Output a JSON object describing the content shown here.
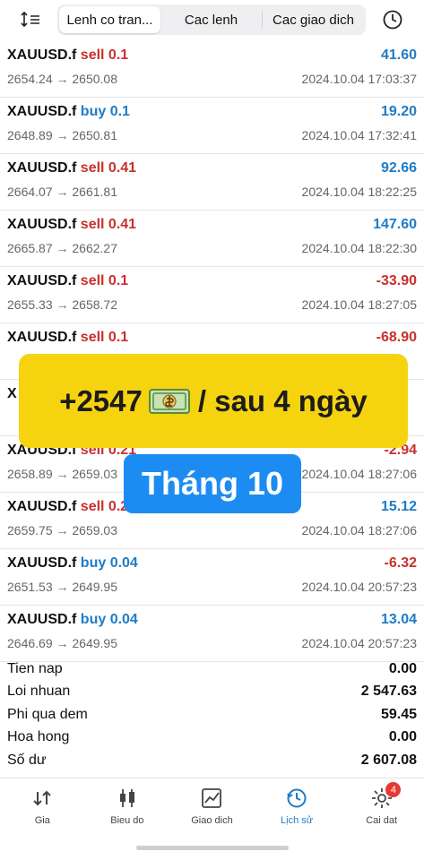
{
  "tabs": [
    {
      "label": "Lenh co tran..."
    },
    {
      "label": "Cac lenh"
    },
    {
      "label": "Cac giao dich"
    }
  ],
  "deals": [
    {
      "symbol": "XAUUSD.f",
      "side": "sell 0.1",
      "profit": "41.60",
      "prices": "2654.24 → 2650.08",
      "time": "2024.10.04 17:03:37"
    },
    {
      "symbol": "XAUUSD.f",
      "side": "buy 0.1",
      "profit": "19.20",
      "prices": "2648.89 → 2650.81",
      "time": "2024.10.04 17:32:41"
    },
    {
      "symbol": "XAUUSD.f",
      "side": "sell 0.41",
      "profit": "92.66",
      "prices": "2664.07 → 2661.81",
      "time": "2024.10.04 18:22:25"
    },
    {
      "symbol": "XAUUSD.f",
      "side": "sell 0.41",
      "profit": "147.60",
      "prices": "2665.87 → 2662.27",
      "time": "2024.10.04 18:22:30"
    },
    {
      "symbol": "XAUUSD.f",
      "side": "sell 0.1",
      "profit": "-33.90",
      "prices": "2655.33 → 2658.72",
      "time": "2024.10.04 18:27:05"
    },
    {
      "symbol": "XAUUSD.f",
      "side": "sell 0.1",
      "profit": "-68.90",
      "prices": "",
      "time": ""
    },
    {
      "symbol": "X",
      "side": "",
      "profit": "",
      "prices": "",
      "time": ""
    },
    {
      "symbol": "XAUUSD.f",
      "side": "sell 0.21",
      "profit": "-2.94",
      "prices": "2658.89 → 2659.03",
      "time": "2024.10.04 18:27:06"
    },
    {
      "symbol": "XAUUSD.f",
      "side": "sell 0.21",
      "profit": "15.12",
      "prices": "2659.75 → 2659.03",
      "time": "2024.10.04 18:27:06"
    },
    {
      "symbol": "XAUUSD.f",
      "side": "buy 0.04",
      "profit": "-6.32",
      "prices": "2651.53 → 2649.95",
      "time": "2024.10.04 20:57:23"
    },
    {
      "symbol": "XAUUSD.f",
      "side": "buy 0.04",
      "profit": "13.04",
      "prices": "2646.69 → 2649.95",
      "time": "2024.10.04 20:57:23"
    }
  ],
  "summary": [
    {
      "label": "Tien nap",
      "value": "0.00"
    },
    {
      "label": "Loi nhuan",
      "value": "2 547.63"
    },
    {
      "label": "Phi qua dem",
      "value": "59.45"
    },
    {
      "label": "Hoa hong",
      "value": "0.00"
    },
    {
      "label": "Số dư",
      "value": "2 607.08"
    }
  ],
  "nav": [
    {
      "label": "Gia",
      "icon": "price-arrows-icon"
    },
    {
      "label": "Bieu do",
      "icon": "candlestick-icon"
    },
    {
      "label": "Giao dich",
      "icon": "trade-chart-icon"
    },
    {
      "label": "Lịch sử",
      "icon": "history-clock-icon",
      "active": true
    },
    {
      "label": "Cai dat",
      "icon": "settings-gear-icon",
      "badge": "4"
    }
  ],
  "overlay": {
    "headline_left": "+2547",
    "headline_right": "/ sau 4 ngày",
    "month": "Tháng 10"
  },
  "colors": {
    "sell": "#c9302c",
    "buy": "#1e7cc6",
    "accent": "#1e7cc6",
    "banner_yellow": "#f6d30f",
    "banner_blue": "#1d8cf2"
  }
}
